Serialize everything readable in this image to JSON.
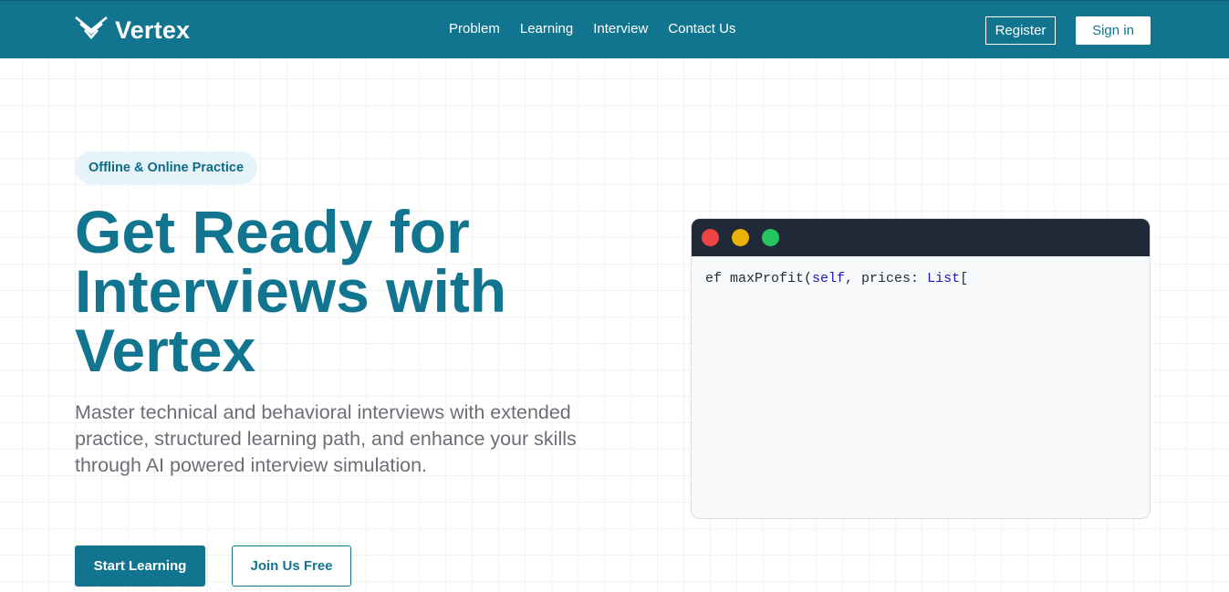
{
  "nav": {
    "brand": "Vertex",
    "links": [
      "Problem",
      "Learning",
      "Interview",
      "Contact Us"
    ],
    "register_label": "Register",
    "signin_label": "Sign in"
  },
  "hero": {
    "badge": "Offline & Online Practice",
    "title": "Get Ready for Interviews with Vertex",
    "subtitle": "Master technical and behavioral interviews with extended practice, structured learning path, and enhance your skills through AI powered interview simulation.",
    "primary_cta": "Start Learning",
    "secondary_cta": "Join Us Free"
  },
  "code_window": {
    "tokens": [
      {
        "text": "ef maxProfit(",
        "kind": "plain"
      },
      {
        "text": "self",
        "kind": "keyword"
      },
      {
        "text": ", prices: ",
        "kind": "plain"
      },
      {
        "text": "List",
        "kind": "keyword"
      },
      {
        "text": "[",
        "kind": "plain"
      }
    ]
  },
  "colors": {
    "brand": "#12758f",
    "code_titlebar": "#1f2937",
    "dot_red": "#ef4444",
    "dot_yellow": "#eab308",
    "dot_green": "#22c55e"
  },
  "icons": {
    "logo": "chevron-stack-logo-icon"
  }
}
